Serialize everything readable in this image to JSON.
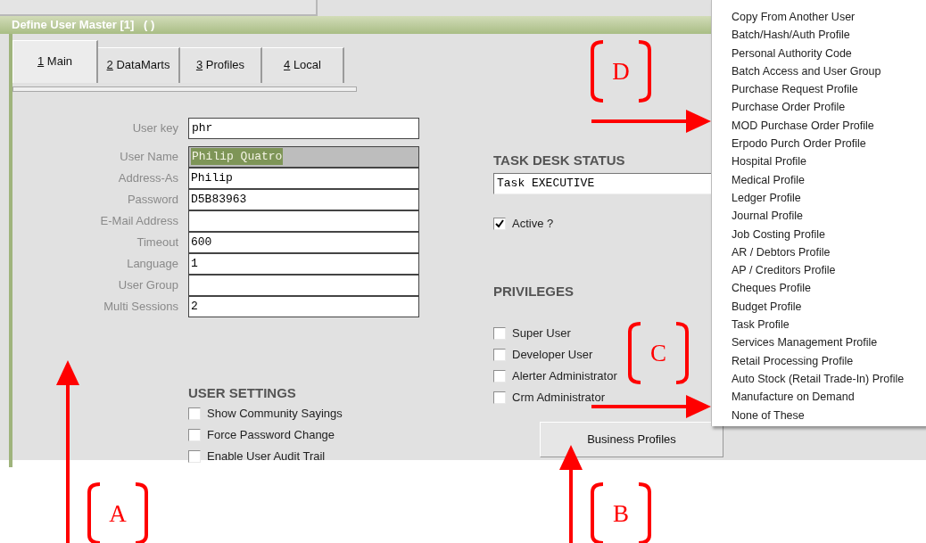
{
  "window": {
    "title": "Define User Master [1]   ( )"
  },
  "tabs": [
    {
      "key": "1",
      "label": "Main",
      "selected": true
    },
    {
      "key": "2",
      "label": "DataMarts",
      "selected": false
    },
    {
      "key": "3",
      "label": "Profiles",
      "selected": false
    },
    {
      "key": "4",
      "label": "Local",
      "selected": false
    }
  ],
  "user_key": {
    "label": "User key",
    "value": "phr"
  },
  "fields": [
    {
      "label": "User Name",
      "value": "Philip Quatro",
      "highlighted": true
    },
    {
      "label": "Address-As",
      "value": "Philip",
      "highlighted": false
    },
    {
      "label": "Password",
      "value": "D5B83963",
      "highlighted": false
    },
    {
      "label": "E-Mail Address",
      "highlighted": false
    },
    {
      "label": "Timeout",
      "value": "600",
      "highlighted": false
    },
    {
      "label": "Language",
      "value": "1",
      "highlighted": false
    },
    {
      "label": "User Group",
      "highlighted": false
    },
    {
      "label": "Multi Sessions",
      "value": "2",
      "highlighted": false
    }
  ],
  "user_settings": {
    "heading": "USER SETTINGS",
    "options": [
      {
        "label": "Show Community Sayings",
        "checked": false
      },
      {
        "label": "Force Password Change",
        "checked": false
      },
      {
        "label": "Enable User Audit Trail",
        "checked": false
      }
    ]
  },
  "task_desk": {
    "heading": "TASK DESK STATUS",
    "value": "Task EXECUTIVE",
    "active": {
      "label": "Active ?",
      "checked": true
    }
  },
  "privileges": {
    "heading": "PRIVILEGES",
    "options": [
      {
        "label": "Super User",
        "checked": false
      },
      {
        "label": "Developer User",
        "checked": false
      },
      {
        "label": "Alerter Administrator",
        "checked": false
      },
      {
        "label": "Crm Administrator",
        "checked": false
      }
    ]
  },
  "business_profiles_button": "Business Profiles",
  "menu": [
    "Copy From Another User",
    "Batch/Hash/Auth Profile",
    "Personal Authority Code",
    "Batch Access and User Group",
    "Purchase Request Profile",
    "Purchase Order Profile",
    "MOD Purchase Order Profile",
    "Erpodo Purch Order Profile",
    "Hospital Profile",
    "Medical Profile",
    "Ledger Profile",
    "Journal Profile",
    "Job Costing Profile",
    "AR / Debtors Profile",
    "AP / Creditors Profile",
    "Cheques Profile",
    "Budget Profile",
    "Task Profile",
    "Services Management Profile",
    "Retail Processing Profile",
    "Auto Stock (Retail Trade-In) Profile",
    "Manufacture on Demand",
    "None of These"
  ],
  "callouts": [
    {
      "letter": "A"
    },
    {
      "letter": "B"
    },
    {
      "letter": "C"
    },
    {
      "letter": "D"
    }
  ]
}
